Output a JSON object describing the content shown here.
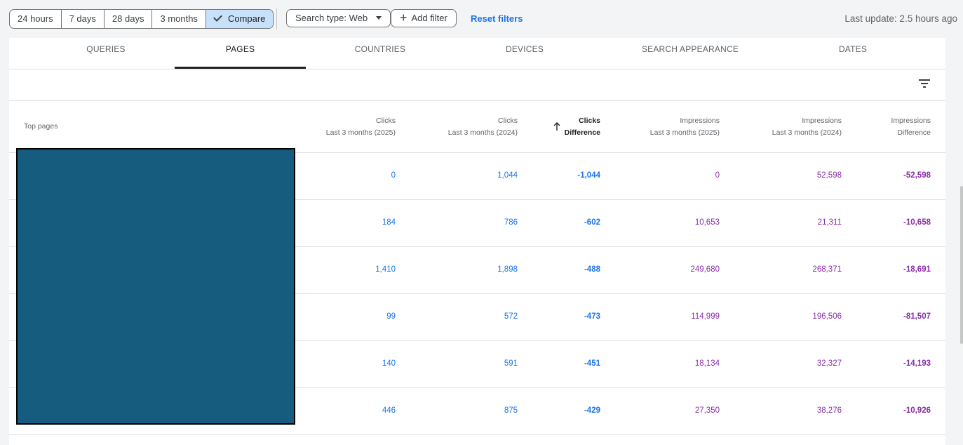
{
  "toolbar": {
    "date_ranges": [
      "24 hours",
      "7 days",
      "28 days",
      "3 months"
    ],
    "compare_label": "Compare",
    "search_type_label": "Search type: Web",
    "add_filter_label": "Add filter",
    "reset_filters_label": "Reset filters",
    "last_update": "Last update: 2.5 hours ago"
  },
  "tabs": [
    "QUERIES",
    "PAGES",
    "COUNTRIES",
    "DEVICES",
    "SEARCH APPEARANCE",
    "DATES"
  ],
  "active_tab": "PAGES",
  "table": {
    "row_header": "Top pages",
    "columns": [
      {
        "line1": "Clicks",
        "line2": "Last 3 months (2025)"
      },
      {
        "line1": "Clicks",
        "line2": "Last 3 months (2024)"
      },
      {
        "line1": "Clicks",
        "line2": "Difference"
      },
      {
        "line1": "Impressions",
        "line2": "Last 3 months (2025)"
      },
      {
        "line1": "Impressions",
        "line2": "Last 3 months (2024)"
      },
      {
        "line1": "Impressions",
        "line2": "Difference"
      }
    ],
    "rows": [
      [
        "0",
        "1,044",
        "-1,044",
        "0",
        "52,598",
        "-52,598"
      ],
      [
        "184",
        "786",
        "-602",
        "10,653",
        "21,311",
        "-10,658"
      ],
      [
        "1,410",
        "1,898",
        "-488",
        "249,680",
        "268,371",
        "-18,691"
      ],
      [
        "99",
        "572",
        "-473",
        "114,999",
        "196,506",
        "-81,507"
      ],
      [
        "140",
        "591",
        "-451",
        "18,134",
        "32,327",
        "-14,193"
      ],
      [
        "446",
        "875",
        "-429",
        "27,350",
        "38,276",
        "-10,926"
      ]
    ]
  },
  "colors": {
    "clicks": "#1a73e8",
    "impressions": "#8a2ea6",
    "compare_active": "#c7e1fb",
    "redaction": "#165c7f"
  }
}
